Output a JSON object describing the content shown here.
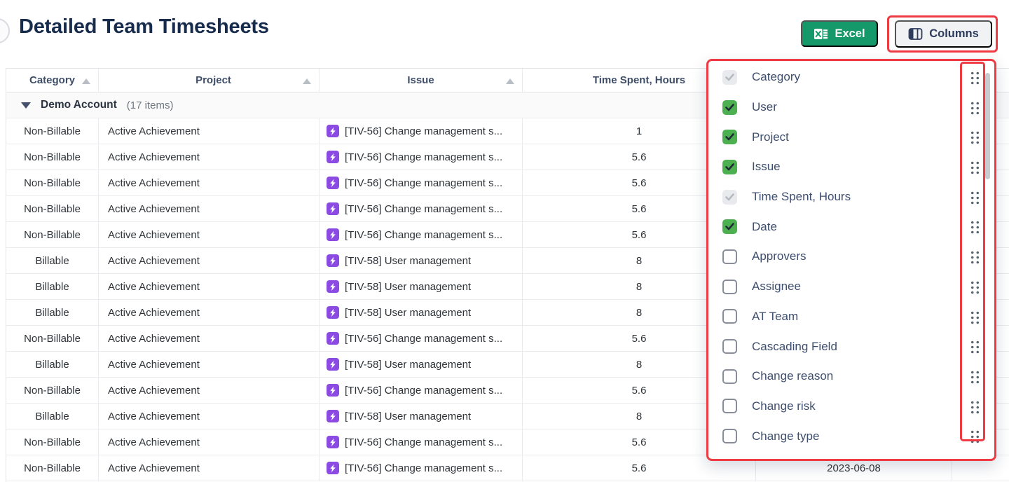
{
  "page": {
    "title": "Detailed Team Timesheets"
  },
  "toolbar": {
    "excel_label": "Excel",
    "columns_label": "Columns"
  },
  "colors": {
    "annotation_red": "#ee3a42",
    "excel_green": "#16996a",
    "checkbox_green": "#4caf50",
    "issue_purple": "#8b4be2",
    "title_navy": "#172b4d"
  },
  "table": {
    "headers": {
      "category": "Category",
      "project": "Project",
      "issue": "Issue",
      "time_spent": "Time Spent, Hours"
    },
    "group": {
      "name": "Demo Account",
      "count_label": "(17 items)"
    },
    "rows": [
      {
        "category": "Non-Billable",
        "project": "Active Achievement",
        "issue": "[TIV-56] Change management s...",
        "hours": "1",
        "date": ""
      },
      {
        "category": "Non-Billable",
        "project": "Active Achievement",
        "issue": "[TIV-56] Change management s...",
        "hours": "5.6",
        "date": ""
      },
      {
        "category": "Non-Billable",
        "project": "Active Achievement",
        "issue": "[TIV-56] Change management s...",
        "hours": "5.6",
        "date": ""
      },
      {
        "category": "Non-Billable",
        "project": "Active Achievement",
        "issue": "[TIV-56] Change management s...",
        "hours": "5.6",
        "date": ""
      },
      {
        "category": "Non-Billable",
        "project": "Active Achievement",
        "issue": "[TIV-56] Change management s...",
        "hours": "5.6",
        "date": ""
      },
      {
        "category": "Billable",
        "project": "Active Achievement",
        "issue": "[TIV-58] User management",
        "hours": "8",
        "date": ""
      },
      {
        "category": "Billable",
        "project": "Active Achievement",
        "issue": "[TIV-58] User management",
        "hours": "8",
        "date": ""
      },
      {
        "category": "Billable",
        "project": "Active Achievement",
        "issue": "[TIV-58] User management",
        "hours": "8",
        "date": ""
      },
      {
        "category": "Non-Billable",
        "project": "Active Achievement",
        "issue": "[TIV-56] Change management s...",
        "hours": "5.6",
        "date": ""
      },
      {
        "category": "Billable",
        "project": "Active Achievement",
        "issue": "[TIV-58] User management",
        "hours": "8",
        "date": ""
      },
      {
        "category": "Non-Billable",
        "project": "Active Achievement",
        "issue": "[TIV-56] Change management s...",
        "hours": "5.6",
        "date": ""
      },
      {
        "category": "Billable",
        "project": "Active Achievement",
        "issue": "[TIV-58] User management",
        "hours": "8",
        "date": ""
      },
      {
        "category": "Non-Billable",
        "project": "Active Achievement",
        "issue": "[TIV-56] Change management s...",
        "hours": "5.6",
        "date": ""
      },
      {
        "category": "Non-Billable",
        "project": "Active Achievement",
        "issue": "[TIV-56] Change management s...",
        "hours": "5.6",
        "date": "2023-06-08"
      }
    ]
  },
  "columns_panel": {
    "items": [
      {
        "label": "Category",
        "state": "checked-disabled"
      },
      {
        "label": "User",
        "state": "checked"
      },
      {
        "label": "Project",
        "state": "checked"
      },
      {
        "label": "Issue",
        "state": "checked"
      },
      {
        "label": "Time Spent, Hours",
        "state": "checked-disabled"
      },
      {
        "label": "Date",
        "state": "checked"
      },
      {
        "label": "Approvers",
        "state": "unchecked"
      },
      {
        "label": "Assignee",
        "state": "unchecked"
      },
      {
        "label": "AT Team",
        "state": "unchecked"
      },
      {
        "label": "Cascading Field",
        "state": "unchecked"
      },
      {
        "label": "Change reason",
        "state": "unchecked"
      },
      {
        "label": "Change risk",
        "state": "unchecked"
      },
      {
        "label": "Change type",
        "state": "unchecked"
      }
    ]
  }
}
